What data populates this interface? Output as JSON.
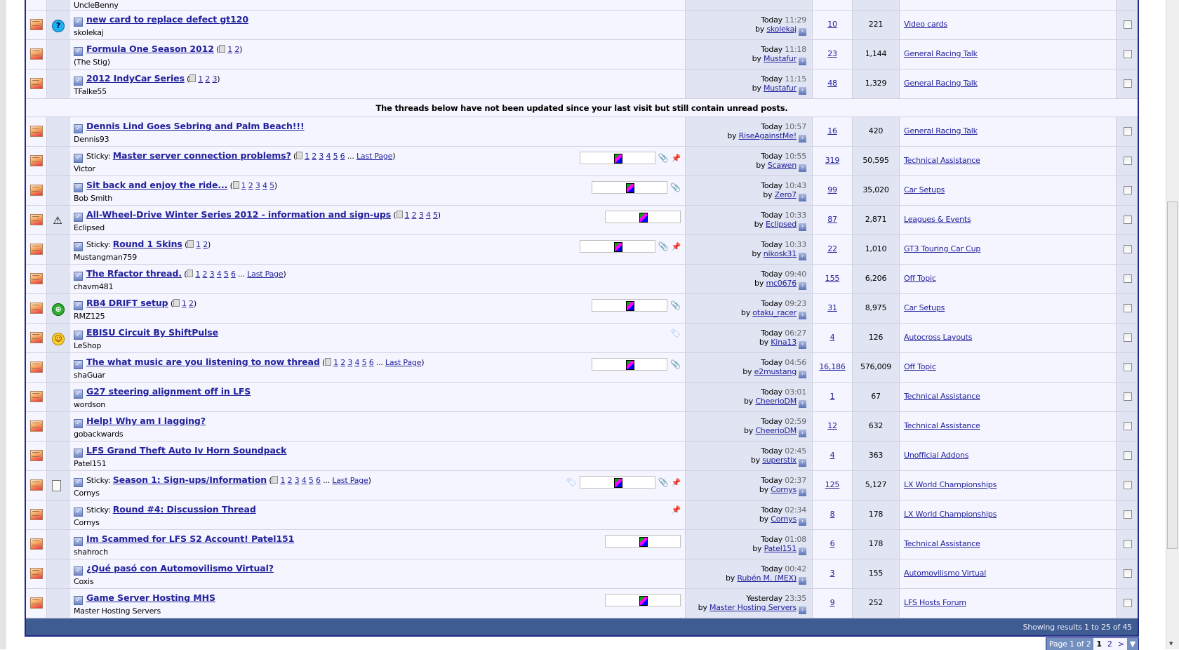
{
  "partial_author": "UncleBenny",
  "separator_text": "The threads below have not been updated since your last visit but still contain unread posts.",
  "sticky_prefix": "Sticky:",
  "last_page_label": "Last Page",
  "by_label": "by",
  "threads_new": [
    {
      "status_icon": "question-icon",
      "title": "new card to replace defect gt120",
      "pages": [],
      "author": "skolekaj",
      "date": "Today",
      "time": "11:29",
      "last_poster": "skolekaj",
      "replies": "10",
      "views": "221",
      "forum": "Video cards"
    },
    {
      "status_icon": "",
      "title": "Formula One Season 2012",
      "pages": [
        "1",
        "2"
      ],
      "author": "(The Stig)",
      "date": "Today",
      "time": "11:18",
      "last_poster": "Mustafur",
      "replies": "23",
      "views": "1,144",
      "forum": "General Racing Talk"
    },
    {
      "status_icon": "",
      "title": "2012 IndyCar Series",
      "pages": [
        "1",
        "2",
        "3"
      ],
      "author": "TFalke55",
      "date": "Today",
      "time": "11:15",
      "last_poster": "Mustafur",
      "replies": "48",
      "views": "1,329",
      "forum": "General Racing Talk"
    }
  ],
  "threads_old": [
    {
      "title": "Dennis Lind Goes Sebring and Palm Beach!!!",
      "pages": [],
      "author": "Dennis93",
      "date": "Today",
      "time": "10:57",
      "last_poster": "RiseAgainstMe!",
      "replies": "16",
      "views": "420",
      "forum": "General Racing Talk"
    },
    {
      "sticky": true,
      "title": "Master server connection problems?",
      "pages": [
        "1",
        "2",
        "3",
        "4",
        "5",
        "6"
      ],
      "last_page": true,
      "author": "Victor",
      "rating": true,
      "clip": true,
      "pin": true,
      "date": "Today",
      "time": "10:55",
      "last_poster": "Scawen",
      "replies": "319",
      "views": "50,595",
      "forum": "Technical Assistance"
    },
    {
      "title": "Sit back and enjoy the ride...",
      "pages": [
        "1",
        "2",
        "3",
        "4",
        "5"
      ],
      "author": "Bob Smith",
      "rating": true,
      "clip": true,
      "date": "Today",
      "time": "10:43",
      "last_poster": "Zero7",
      "replies": "99",
      "views": "35,020",
      "forum": "Car Setups"
    },
    {
      "status_icon": "warning-icon",
      "title": "All-Wheel-Drive Winter Series 2012 - information and sign-ups",
      "pages": [
        "1",
        "2",
        "3",
        "4",
        "5"
      ],
      "author": "Eclipsed",
      "rating": true,
      "date": "Today",
      "time": "10:33",
      "last_poster": "Eclipsed",
      "replies": "87",
      "views": "2,871",
      "forum": "Leagues & Events"
    },
    {
      "sticky": true,
      "title": "Round 1 Skins",
      "pages": [
        "1",
        "2"
      ],
      "author": "Mustangman759",
      "rating": true,
      "clip": true,
      "pin": true,
      "date": "Today",
      "time": "10:33",
      "last_poster": "nikosk31",
      "replies": "22",
      "views": "1,010",
      "forum": "GT3 Touring Car Cup"
    },
    {
      "title": "The Rfactor thread.",
      "pages": [
        "1",
        "2",
        "3",
        "4",
        "5",
        "6"
      ],
      "last_page": true,
      "author": "chavm481",
      "date": "Today",
      "time": "09:40",
      "last_poster": "mc0676",
      "replies": "155",
      "views": "6,206",
      "forum": "Off Topic"
    },
    {
      "status_icon": "globe-icon",
      "title": "RB4 DRIFT setup",
      "pages": [
        "1",
        "2"
      ],
      "author": "RMZ125",
      "rating": true,
      "clip": true,
      "date": "Today",
      "time": "09:23",
      "last_poster": "otaku_racer",
      "replies": "31",
      "views": "8,975",
      "forum": "Car Setups"
    },
    {
      "status_icon": "smile-icon",
      "title": "EBISU Circuit By ShiftPulse",
      "pages": [],
      "author": "LeShop",
      "tag": true,
      "date": "Today",
      "time": "06:27",
      "last_poster": "Kina13",
      "replies": "4",
      "views": "126",
      "forum": "Autocross Layouts"
    },
    {
      "title": "The what music are you listening to now thread",
      "pages": [
        "1",
        "2",
        "3",
        "4",
        "5",
        "6"
      ],
      "last_page": true,
      "author": "shaGuar",
      "rating": true,
      "clip": true,
      "date": "Today",
      "time": "04:56",
      "last_poster": "e2mustang",
      "replies": "16,186",
      "views": "576,009",
      "forum": "Off Topic"
    },
    {
      "title": "G27 steering alignment off in LFS",
      "pages": [],
      "author": "wordson",
      "date": "Today",
      "time": "03:01",
      "last_poster": "CheerioDM",
      "replies": "1",
      "views": "67",
      "forum": "Technical Assistance"
    },
    {
      "title": "Help! Why am I lagging?",
      "pages": [],
      "author": "gobackwards",
      "date": "Today",
      "time": "02:59",
      "last_poster": "CheerioDM",
      "replies": "12",
      "views": "632",
      "forum": "Technical Assistance"
    },
    {
      "title": "LFS Grand Theft Auto Iv Horn Soundpack",
      "pages": [],
      "author": "Patel151",
      "date": "Today",
      "time": "02:45",
      "last_poster": "superstix",
      "replies": "4",
      "views": "363",
      "forum": "Unofficial Addons"
    },
    {
      "status_icon": "document-icon",
      "sticky": true,
      "title": "Season 1: Sign-ups/Information",
      "pages": [
        "1",
        "2",
        "3",
        "4",
        "5",
        "6"
      ],
      "last_page": true,
      "author": "Cornys",
      "tag": true,
      "rating": true,
      "clip": true,
      "pin": true,
      "date": "Today",
      "time": "02:37",
      "last_poster": "Cornys",
      "replies": "125",
      "views": "5,127",
      "forum": "LX World Championships"
    },
    {
      "sticky": true,
      "title": "Round #4: Discussion Thread",
      "pages": [],
      "author": "Cornys",
      "pin": true,
      "date": "Today",
      "time": "02:34",
      "last_poster": "Cornys",
      "replies": "8",
      "views": "178",
      "forum": "LX World Championships"
    },
    {
      "title": "Im Scammed for LFS S2 Account! Patel151",
      "pages": [],
      "author": "shahroch",
      "rating": true,
      "date": "Today",
      "time": "01:08",
      "last_poster": "Patel151",
      "replies": "6",
      "views": "178",
      "forum": "Technical Assistance"
    },
    {
      "title": "¿Qué pasó con Automovilismo Virtual?",
      "pages": [],
      "author": "Coxis",
      "date": "Today",
      "time": "00:42",
      "last_poster": "Rubén M. (MEX)",
      "replies": "3",
      "views": "155",
      "forum": "Automovilismo Virtual"
    },
    {
      "title": "Game Server Hosting MHS",
      "pages": [],
      "author": "Master Hosting Servers",
      "rating": true,
      "date": "Yesterday",
      "time": "23:35",
      "last_poster": "Master Hosting Servers",
      "replies": "9",
      "views": "252",
      "forum": "LFS Hosts Forum"
    }
  ],
  "footer": {
    "results_text": "Showing results 1 to 25 of 45"
  },
  "pagenav": {
    "label": "Page 1 of 2",
    "current": "1",
    "next_page": "2",
    "next": ">",
    "menu": "▼"
  }
}
